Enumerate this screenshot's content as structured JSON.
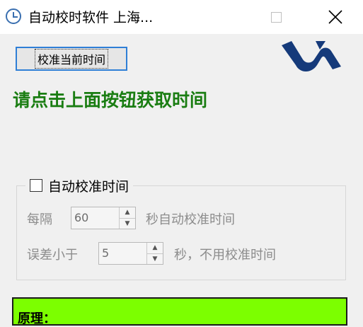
{
  "window": {
    "title": "自动校时软件 上海..."
  },
  "toolbar": {
    "calibrate_label": "校准当前时间"
  },
  "status": {
    "message": "请点击上面按钮获取时间",
    "color": "#1a7d12"
  },
  "auto_group": {
    "checkbox_label": "自动校准时间",
    "checked": false,
    "interval": {
      "prefix": "每隔",
      "value": "60",
      "suffix": "秒自动校准时间"
    },
    "tolerance": {
      "prefix": "误差小于",
      "value": "5",
      "suffix": "秒，不用校准时间"
    }
  },
  "info_panel": {
    "label": "原理：",
    "color": "#7cff00"
  },
  "icons": {
    "app": "clock-icon",
    "logo": "brand-logo-icon",
    "maximize": "maximize-icon",
    "close": "close-icon"
  }
}
